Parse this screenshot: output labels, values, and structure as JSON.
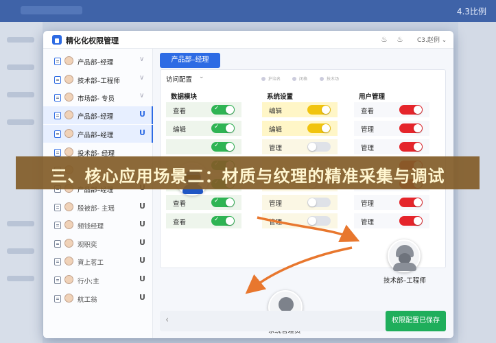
{
  "background": {
    "ratio_label": "4.3比例"
  },
  "window": {
    "title": "精化化权限管理",
    "user_label": "C3.赵例"
  },
  "sidebar": {
    "items": [
      {
        "label": "产品部–经理",
        "marker": "chevron",
        "active": false
      },
      {
        "label": "技术部–工程师",
        "marker": "chevron",
        "active": false
      },
      {
        "label": "市场部- 专员",
        "marker": "chevron",
        "active": false
      },
      {
        "label": "产品部–经理",
        "marker": "U",
        "active": true
      },
      {
        "label": "产品部–经理",
        "marker": "U",
        "active": true
      },
      {
        "label": "投术部- 经理",
        "marker": "none",
        "active": false
      },
      {
        "label": "",
        "marker": "none",
        "active": false
      },
      {
        "label": "产品部–经理",
        "marker": "U",
        "active": false
      },
      {
        "label": "殷被部- 主瑶",
        "marker": "U",
        "active": false
      },
      {
        "label": "频钱经理",
        "marker": "U",
        "active": false
      },
      {
        "label": "观职奕",
        "marker": "U",
        "active": false
      },
      {
        "label": "資上茗工",
        "marker": "U",
        "active": false
      },
      {
        "label": "行小;主",
        "marker": "U",
        "active": false
      },
      {
        "label": "航工翁",
        "marker": "U",
        "active": false
      }
    ]
  },
  "main": {
    "role_tab": "产品部–经理",
    "access_label": "访问配置",
    "legend": [
      "护治名",
      "闭格",
      "技木场"
    ],
    "columns": [
      {
        "title": "数据模块",
        "rows": [
          {
            "label": "查看",
            "state": "on",
            "color": "#2fb454",
            "highlight": "none"
          },
          {
            "label": "编辑",
            "state": "on",
            "color": "#2fb454",
            "highlight": "none"
          },
          {
            "label": "",
            "state": "on",
            "color": "#2fb454",
            "highlight": "none"
          },
          {
            "label": "",
            "state": "on",
            "color": "#2fb454",
            "highlight": "none"
          },
          {
            "label": "",
            "state": "on",
            "color": "#2fb454",
            "highlight": "none"
          },
          {
            "label": "查看",
            "state": "on",
            "color": "#2fb454",
            "highlight": "none"
          },
          {
            "label": "查看",
            "state": "on",
            "color": "#2fb454",
            "highlight": "none"
          }
        ]
      },
      {
        "title": "系统设置",
        "rows": [
          {
            "label": "编辑",
            "state": "on",
            "color": "#f1c40f",
            "highlight": "yellow"
          },
          {
            "label": "编辑",
            "state": "on",
            "color": "#f1c40f",
            "highlight": "yellow"
          },
          {
            "label": "管理",
            "state": "off",
            "color": "#dfe2e8",
            "highlight": "none"
          },
          {
            "label": "",
            "state": "off",
            "color": "#dfe2e8",
            "highlight": "none"
          },
          {
            "label": "",
            "state": "off",
            "color": "#dfe2e8",
            "highlight": "none"
          },
          {
            "label": "管理",
            "state": "off",
            "color": "#dfe2e8",
            "highlight": "none"
          },
          {
            "label": "管理",
            "state": "off",
            "color": "#dfe2e8",
            "highlight": "none"
          }
        ]
      },
      {
        "title": "用户管理",
        "rows": [
          {
            "label": "查看",
            "state": "on",
            "color": "#e5252b",
            "highlight": "none"
          },
          {
            "label": "管理",
            "state": "on",
            "color": "#e5252b",
            "highlight": "none"
          },
          {
            "label": "管理",
            "state": "on",
            "color": "#e5252b",
            "highlight": "none"
          },
          {
            "label": "",
            "state": "on",
            "color": "#e5252b",
            "highlight": "none"
          },
          {
            "label": "",
            "state": "on",
            "color": "#e5252b",
            "highlight": "none"
          },
          {
            "label": "管理",
            "state": "on",
            "color": "#e5252b",
            "highlight": "none"
          },
          {
            "label": "管理",
            "state": "on",
            "color": "#e5252b",
            "highlight": "none"
          }
        ]
      }
    ],
    "people": {
      "manager_label": "",
      "engineer_label": "技术部–工程师",
      "admin_label": "系统管理员"
    },
    "save_button": "权限配置已保存"
  },
  "banner": {
    "text": "三、核心应用场景二：材质与纹理的精准采集与调试"
  },
  "colors": {
    "primary": "#2d6be4",
    "success": "#1fae5b",
    "arrow": "#e8772e"
  }
}
